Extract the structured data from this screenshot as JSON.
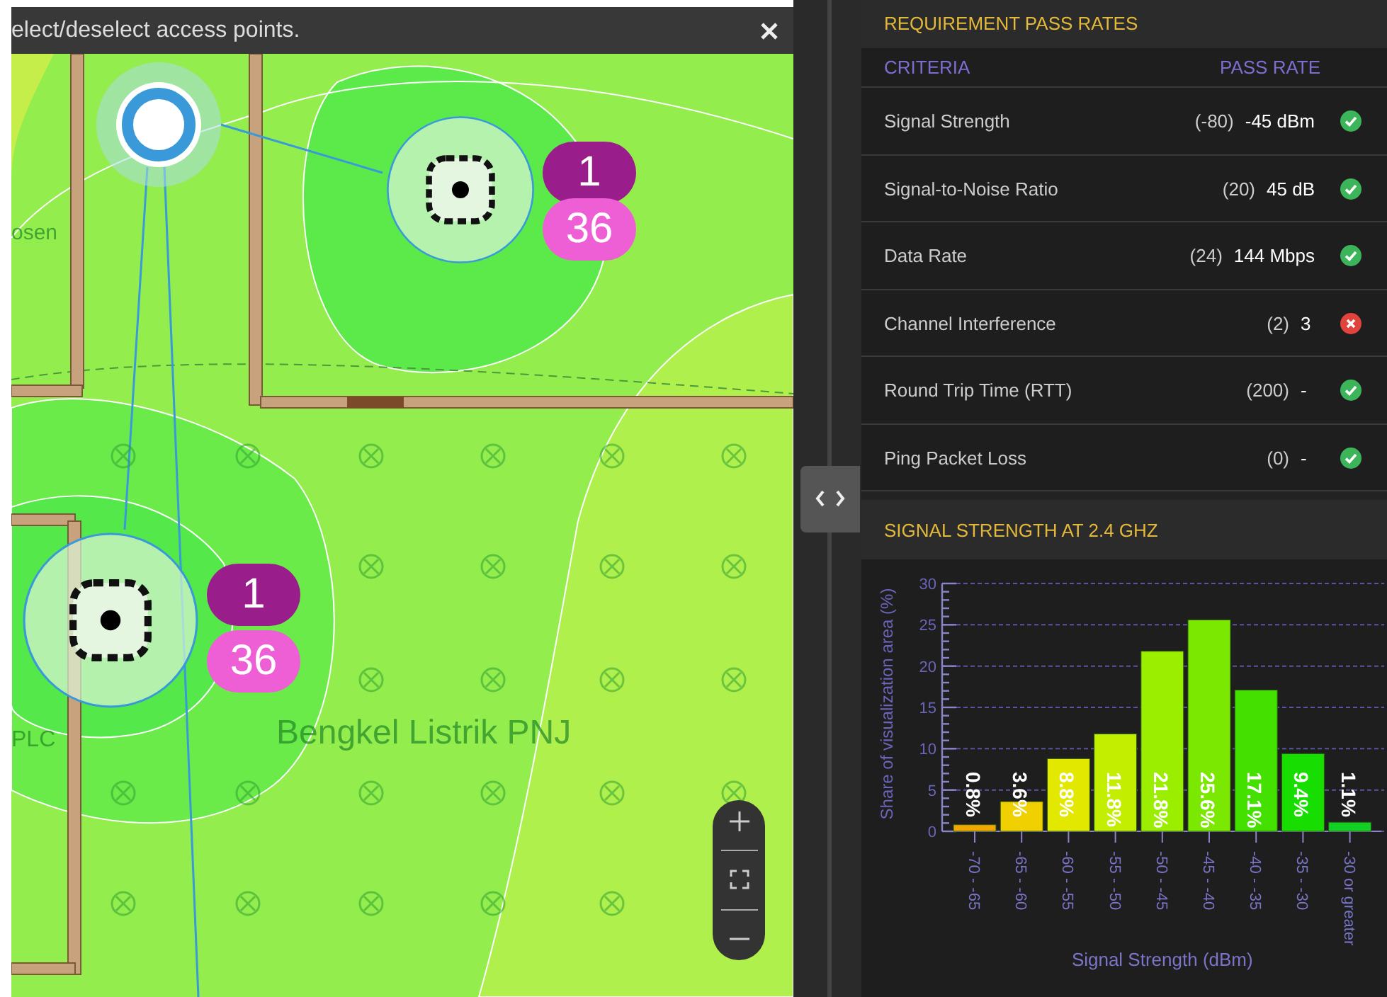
{
  "banner": {
    "text": "elect/deselect access points."
  },
  "map": {
    "room_labels": [
      {
        "text": "osen"
      },
      {
        "text": "PLC"
      },
      {
        "text": "Bengkel Listrik PNJ"
      }
    ],
    "access_points": [
      {
        "channel": "1",
        "count": "36"
      },
      {
        "channel": "1",
        "count": "36"
      }
    ]
  },
  "pass_rates": {
    "title": "REQUIREMENT PASS RATES",
    "columns": [
      "CRITERIA",
      "PASS RATE"
    ],
    "rows": [
      {
        "criteria": "Signal Strength",
        "threshold": "(-80)",
        "value": "-45 dBm",
        "passed": true
      },
      {
        "criteria": "Signal-to-Noise Ratio",
        "threshold": "(20)",
        "value": "45 dB",
        "passed": true
      },
      {
        "criteria": "Data Rate",
        "threshold": "(24)",
        "value": "144 Mbps",
        "passed": true
      },
      {
        "criteria": "Channel Interference",
        "threshold": "(2)",
        "value": "3",
        "passed": false
      },
      {
        "criteria": "Round Trip Time (RTT)",
        "threshold": "(200)",
        "value": "-",
        "passed": true
      },
      {
        "criteria": "Ping Packet Loss",
        "threshold": "(0)",
        "value": "-",
        "passed": true
      }
    ]
  },
  "signal_chart": {
    "title": "SIGNAL STRENGTH AT 2.4 GHZ",
    "chart_data": {
      "type": "bar",
      "xlabel": "Signal Strength (dBm)",
      "ylabel": "Share of visualization area (%)",
      "categories": [
        "-70 - -65",
        "-65 - -60",
        "-60 - -55",
        "-55 - -50",
        "-50 - -45",
        "-45 - -40",
        "-40 - -35",
        "-35 - -30",
        "-30 or greater"
      ],
      "values": [
        0.8,
        3.6,
        8.8,
        11.8,
        21.8,
        25.6,
        17.1,
        9.4,
        1.1
      ],
      "value_labels": [
        "0.8%",
        "3.6%",
        "8.8%",
        "11.8%",
        "21.8%",
        "25.6%",
        "17.1%",
        "9.4%",
        "1.1%"
      ],
      "ylim": [
        0,
        30
      ],
      "grid": true,
      "yticks": [
        0,
        5,
        10,
        15,
        20,
        25,
        30
      ]
    }
  }
}
